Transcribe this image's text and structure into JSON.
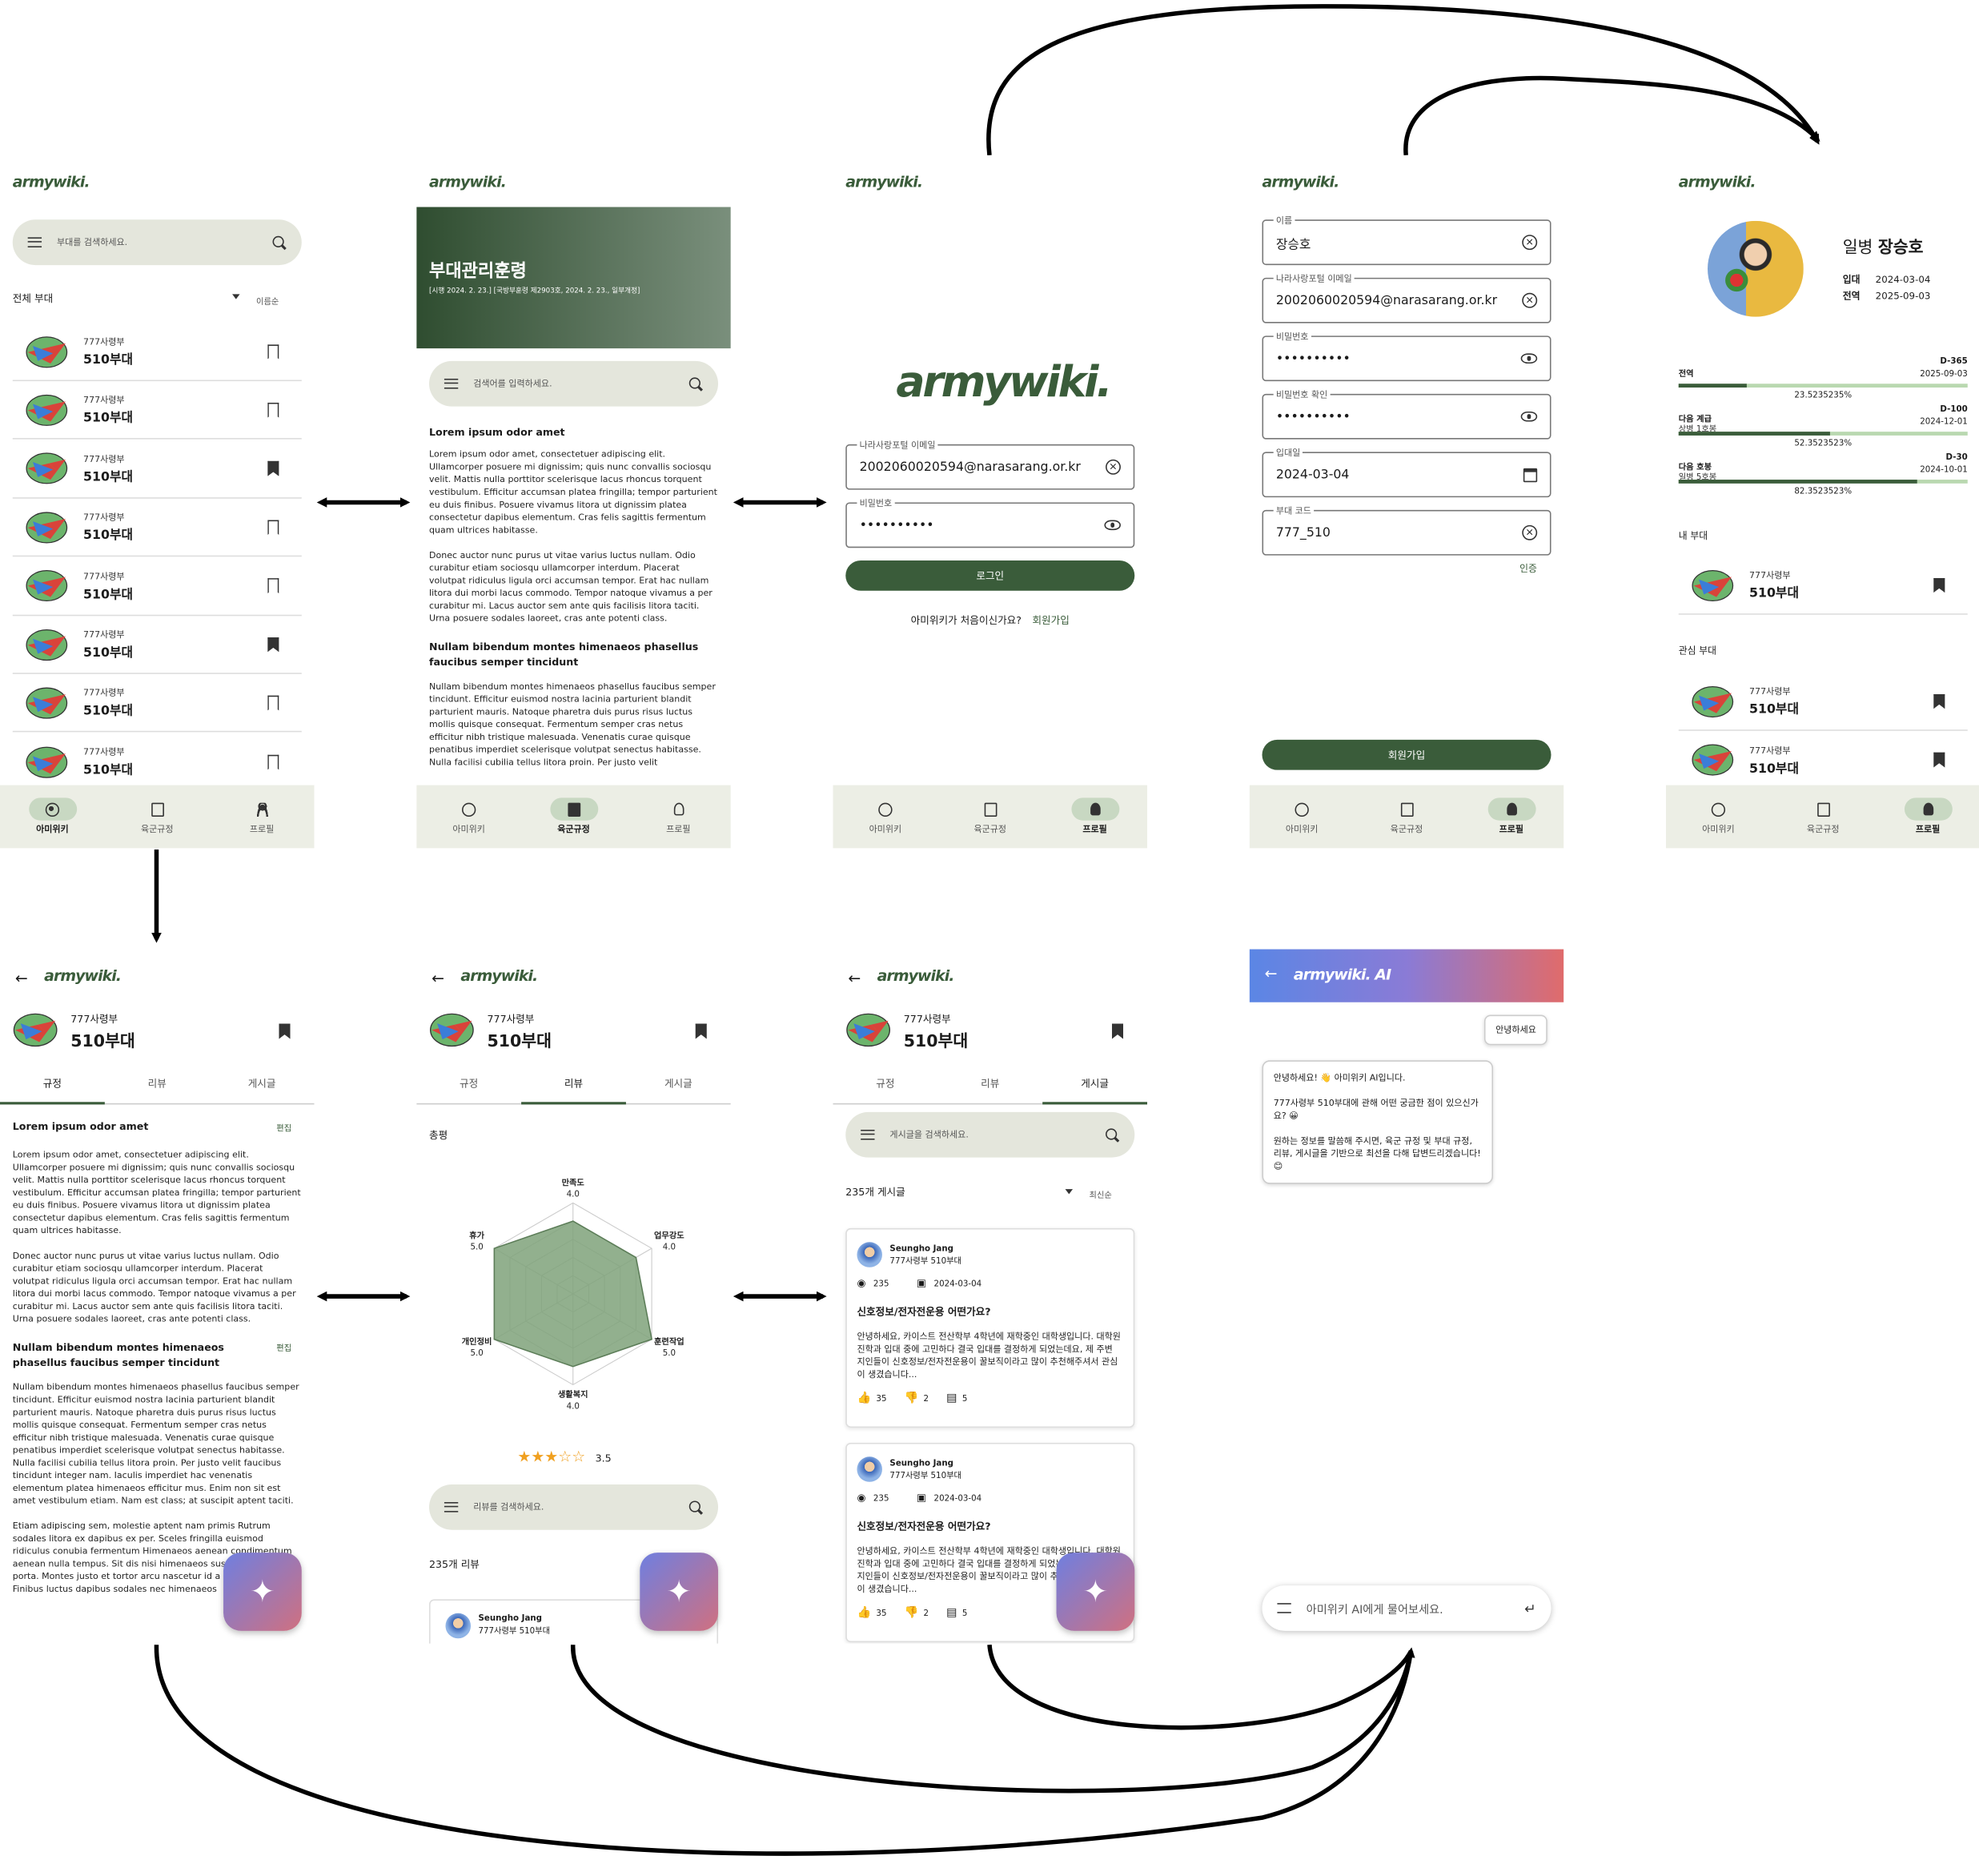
{
  "brand": {
    "logo": "armywiki.",
    "ai_logo": "armywiki. AI",
    "accent": "#3a5c3a",
    "nav_bg": "#eceee5"
  },
  "nav": {
    "wiki": "아미위키",
    "rules": "육군규정",
    "profile": "프로필"
  },
  "screen1": {
    "search_placeholder": "부대를 검색하세요.",
    "filter": "전체 부대",
    "sort": "이름순",
    "units": [
      {
        "sub": "777사령부",
        "name": "510부대",
        "bookmarked": false
      },
      {
        "sub": "777사령부",
        "name": "510부대",
        "bookmarked": false
      },
      {
        "sub": "777사령부",
        "name": "510부대",
        "bookmarked": true
      },
      {
        "sub": "777사령부",
        "name": "510부대",
        "bookmarked": false
      },
      {
        "sub": "777사령부",
        "name": "510부대",
        "bookmarked": false
      },
      {
        "sub": "777사령부",
        "name": "510부대",
        "bookmarked": true
      },
      {
        "sub": "777사령부",
        "name": "510부대",
        "bookmarked": false
      },
      {
        "sub": "777사령부",
        "name": "510부대",
        "bookmarked": false
      }
    ]
  },
  "screen2": {
    "banner_title": "부대관리훈령",
    "banner_sub": "[시행 2024. 2. 23.] [국방부훈령 제2903호, 2024. 2. 23., 일부개정]",
    "search_placeholder": "검색어를 입력하세요.",
    "h1": "Lorem ipsum odor amet",
    "p1": "Lorem ipsum odor amet, consectetuer adipiscing elit. Ullamcorper posuere mi dignissim; quis nunc convallis sociosqu velit. Mattis nulla porttitor scelerisque lacus rhoncus torquent vestibulum. Efficitur accumsan platea fringilla; tempor parturient eu duis finibus. Posuere vivamus litora ut dignissim platea consectetur dapibus elementum. Cras felis sagittis fermentum quam ultrices habitasse.",
    "p2": "Donec auctor nunc purus ut vitae varius luctus nullam. Odio curabitur etiam sociosqu ullamcorper interdum. Placerat volutpat ridiculus ligula orci accumsan tempor. Erat hac nullam litora dui morbi lacus commodo. Tempor natoque vivamus a per curabitur mi. Lacus auctor sem ante quis facilisis litora taciti. Urna posuere sodales laoreet, cras ante potenti class.",
    "h2": "Nullam bibendum montes himenaeos phasellus faucibus semper tincidunt",
    "p3": "Nullam bibendum montes himenaeos phasellus faucibus semper tincidunt. Efficitur euismod nostra lacinia parturient blandit parturient mauris. Natoque pharetra duis purus risus luctus mollis quisque consequat. Fermentum semper cras netus efficitur nibh tristique malesuada. Venenatis curae quisque penatibus imperdiet scelerisque volutpat senectus habitasse. Nulla facilisi cubilia tellus litora proin. Per justo velit"
  },
  "screen3": {
    "email_label": "나라사랑포털 이메일",
    "email_value": "2002060020594@narasarang.or.kr",
    "pw_label": "비밀번호",
    "pw_value": "••••••••••",
    "login": "로그인",
    "first_time": "아미위키가 처음이신가요?",
    "signup_link": "회원가입"
  },
  "screen4": {
    "fields": [
      {
        "label": "이름",
        "value": "장승호",
        "icon": "clear"
      },
      {
        "label": "나라사랑포털 이메일",
        "value": "2002060020594@narasarang.or.kr",
        "icon": "clear"
      },
      {
        "label": "비밀번호",
        "value": "••••••••••",
        "icon": "eye"
      },
      {
        "label": "비밀번호 확인",
        "value": "••••••••••",
        "icon": "eye"
      },
      {
        "label": "입대일",
        "value": "2024-03-04",
        "icon": "calendar"
      },
      {
        "label": "부대 코드",
        "value": "777_510",
        "icon": "clear"
      }
    ],
    "verify": "인증",
    "signup": "회원가입"
  },
  "screen5": {
    "rank": "일병",
    "name": "장승호",
    "enlist_label": "입대",
    "enlist": "2024-03-04",
    "discharge_label": "전역",
    "discharge": "2025-09-03",
    "progress": [
      {
        "title": "전역",
        "sub": "",
        "dday": "D-365",
        "date": "2025-09-03",
        "pct": "23.5235235%",
        "value": 23.5
      },
      {
        "title": "다음 계급",
        "sub": "상병 1호봉",
        "dday": "D-100",
        "date": "2024-12-01",
        "pct": "52.3523523%",
        "value": 52.4
      },
      {
        "title": "다음 호봉",
        "sub": "일병 5호봉",
        "dday": "D-30",
        "date": "2024-10-01",
        "pct": "82.3523523%",
        "value": 82.4
      }
    ],
    "my_unit": "내 부대",
    "fav_units": "관심 부대",
    "unit_sub": "777사령부",
    "unit_name": "510부대"
  },
  "unit_page": {
    "sub": "777사령부",
    "name": "510부대",
    "tabs": [
      "규정",
      "리뷰",
      "게시글"
    ],
    "edit": "편집",
    "h1": "Lorem ipsum odor amet",
    "p1": "Lorem ipsum odor amet, consectetuer adipiscing elit. Ullamcorper posuere mi dignissim; quis nunc convallis sociosqu velit. Mattis nulla porttitor scelerisque lacus rhoncus torquent vestibulum. Efficitur accumsan platea fringilla; tempor parturient eu duis finibus. Posuere vivamus litora ut dignissim platea consectetur dapibus elementum. Cras felis sagittis fermentum quam ultrices habitasse.",
    "p2": "Donec auctor nunc purus ut vitae varius luctus nullam. Odio curabitur etiam sociosqu ullamcorper interdum. Placerat volutpat ridiculus ligula orci accumsan tempor. Erat hac nullam litora dui morbi lacus commodo. Tempor natoque vivamus a per curabitur mi. Lacus auctor sem ante quis facilisis litora taciti. Urna posuere sodales laoreet, cras ante potenti class.",
    "h2": "Nullam bibendum montes himenaeos phasellus faucibus semper tincidunt",
    "p3": "Nullam bibendum montes himenaeos phasellus faucibus semper tincidunt. Efficitur euismod nostra lacinia parturient blandit parturient mauris. Natoque pharetra duis purus risus luctus mollis quisque consequat. Fermentum semper cras netus efficitur nibh tristique malesuada. Venenatis curae quisque penatibus imperdiet scelerisque volutpat senectus habitasse. Nulla facilisi cubilia tellus litora proin. Per justo velit faucibus tincidunt integer nam. Iaculis imperdiet hac venenatis elementum platea himenaeos efficitur mus. Enim non sit est amet vestibulum etiam. Nam est class; at suscipit aptent taciti.",
    "p4": "Etiam adipiscing sem, molestie aptent nam primis Rutrum sodales litora ex dapibus ex per. Sceles fringilla euismod ridiculus conubia fermentum Himenaeos aenean condimentum aenean nulla tempus. Sit dis nisi himenaeos suspendisse cu porta. Montes justo et tortor arcu nascetur id a imperdiet. Finibus luctus dapibus sodales nec himenaeos"
  },
  "review_page": {
    "overall": "총평",
    "axes": [
      {
        "label": "만족도",
        "value": "4.0"
      },
      {
        "label": "업무강도",
        "value": "4.0"
      },
      {
        "label": "훈련작업",
        "value": "5.0"
      },
      {
        "label": "생활복지",
        "value": "4.0"
      },
      {
        "label": "개인정비",
        "value": "5.0"
      },
      {
        "label": "휴가",
        "value": "5.0"
      }
    ],
    "rating": "3.5",
    "search_placeholder": "리뷰를 검색하세요.",
    "count": "235개 리뷰",
    "reviewer": "Seungho Jang",
    "reviewer_unit": "777사령부 510부대"
  },
  "post_page": {
    "search_placeholder": "게시글을 검색하세요.",
    "count": "235개 게시글",
    "sort": "최신순",
    "posts": [
      {
        "author": "Seungho Jang",
        "unit": "777사령부 510부대",
        "views": "235",
        "date": "2024-03-04",
        "title": "신호정보/전자전운용 어떤가요?",
        "body": "안녕하세요, 카이스트 전산학부 4학년에 재학중인 대학생입니다. 대학원 진학과 입대 중에 고민하다 결국 입대를 결정하게 되었는데요, 제 주변 지인들이 신호정보/전자전운용이 꿀보직이라고 많이 추천해주셔서 관심이 생겼습니다...",
        "likes": "35",
        "dislikes": "2",
        "comments": "5"
      },
      {
        "author": "Seungho Jang",
        "unit": "777사령부 510부대",
        "views": "235",
        "date": "2024-03-04",
        "title": "신호정보/전자전운용 어떤가요?",
        "body": "안녕하세요, 카이스트 전산학부 4학년에 재학중인 대학생입니다. 대학원 진학과 입대 중에 고민하다 결국 입대를 결정하게 되었는데요, 제 주변 지인들이 신호정보/전자전운용이 꿀보직이라고 많이 추천해주셔서 관심이 생겼습니다...",
        "likes": "35",
        "dislikes": "2",
        "comments": "5"
      }
    ]
  },
  "ai_page": {
    "user_msg": "안녕하세요",
    "bot_msg1": "안녕하세요! 👋 아미위키 AI입니다.",
    "bot_msg2": "777사령부 510부대에 관해 어떤 궁금한 점이 있으신가요? 😀",
    "bot_msg3": "원하는 정보를 말씀해 주시면, 육군 규정 및 부대 규정, 리뷰, 게시글을 기반으로 최선을 다해 답변드리겠습니다! 😊",
    "input_placeholder": "아미위키 AI에게 물어보세요."
  }
}
